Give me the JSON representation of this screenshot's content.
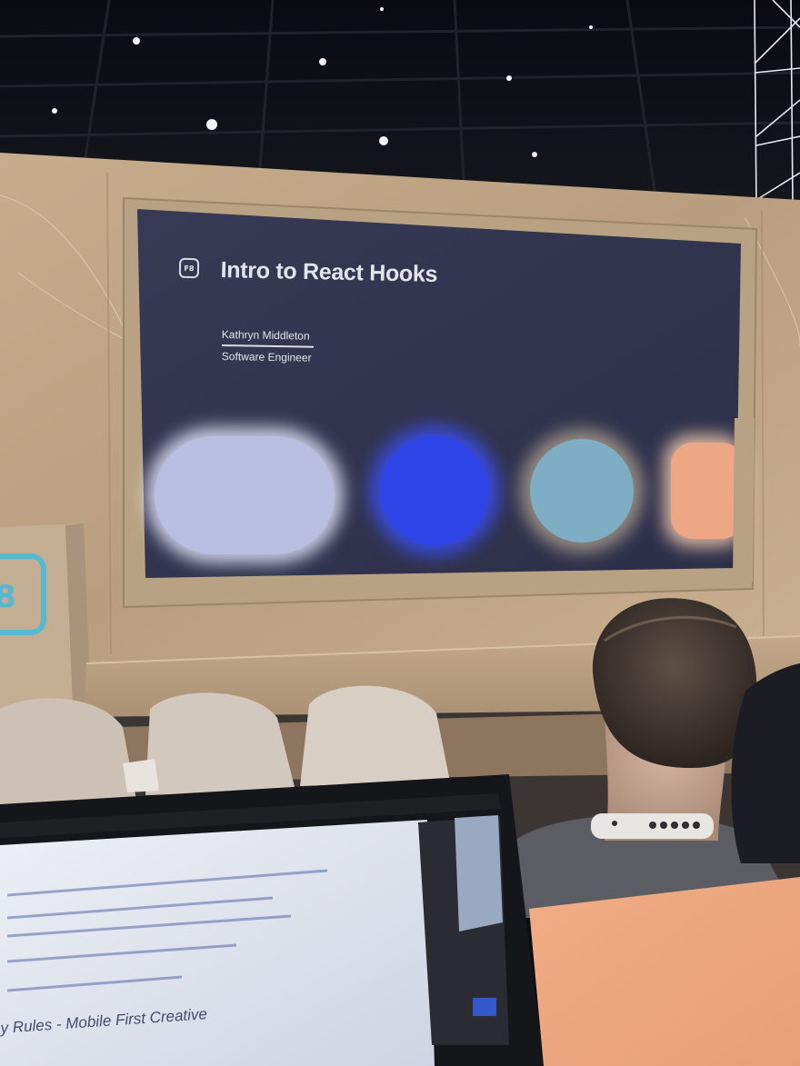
{
  "slide": {
    "logo": "F8",
    "title": "Intro to React Hooks",
    "speaker_name": "Kathryn Middleton",
    "speaker_role": "Software Engineer",
    "shape_colors": [
      "#b9bfe0",
      "#2e44e6",
      "#7eaec4",
      "#eda785"
    ]
  },
  "podium": {
    "logo": "8"
  },
  "laptop": {
    "visible_heading": "y Rules - Mobile First Creative"
  }
}
